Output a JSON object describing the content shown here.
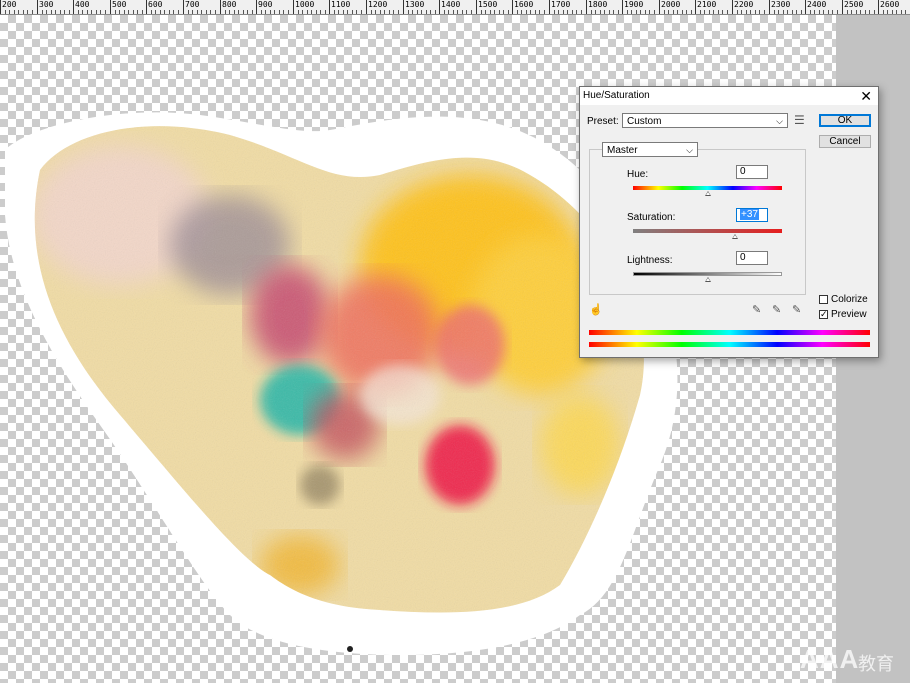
{
  "ruler": {
    "labels": [
      "200",
      "300",
      "400",
      "500",
      "600",
      "700",
      "800",
      "900",
      "1000",
      "1100",
      "1200",
      "1300",
      "1400",
      "1500",
      "1600",
      "1700",
      "1800",
      "1900",
      "2000",
      "2100",
      "2200",
      "2300",
      "2400",
      "2500",
      "2600"
    ]
  },
  "dialog": {
    "title": "Hue/Saturation",
    "preset_label": "Preset:",
    "preset_value": "Custom",
    "channel_value": "Master",
    "hue_label": "Hue:",
    "hue_value": "0",
    "saturation_label": "Saturation:",
    "saturation_value": "+37",
    "lightness_label": "Lightness:",
    "lightness_value": "0",
    "ok_label": "OK",
    "cancel_label": "Cancel",
    "colorize_label": "Colorize",
    "colorize_checked": false,
    "preview_label": "Preview",
    "preview_checked": true,
    "hue_level": 0,
    "saturation_level": 37,
    "lightness_level": 0
  },
  "watermark": {
    "latin": "AAA",
    "cjk": "教育"
  },
  "colors": {
    "accent": "#0078d7",
    "dialog_bg": "#f0f0f0",
    "pasteboard": "#c2c2c2"
  },
  "icons": [
    "close-icon",
    "chevron-down-icon",
    "preset-options-icon",
    "hand-adjust-icon",
    "eyedropper-icon",
    "eyedropper-plus-icon",
    "eyedropper-minus-icon"
  ]
}
